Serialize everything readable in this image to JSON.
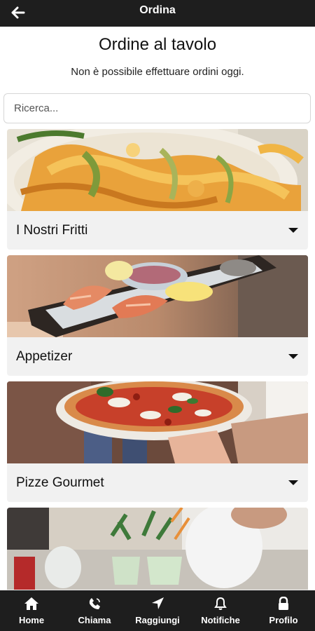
{
  "header": {
    "title": "Ordina",
    "back_icon": "arrow-left-icon"
  },
  "intro": {
    "title": "Ordine al tavolo",
    "subtitle": "Non è possibile effettuare ordini oggi."
  },
  "search": {
    "placeholder": "Ricerca...",
    "value": ""
  },
  "categories": [
    {
      "label": "I Nostri Fritti",
      "image": "fried-food-photo"
    },
    {
      "label": "Appetizer",
      "image": "seafood-platter-photo"
    },
    {
      "label": "Pizze Gourmet",
      "image": "pizza-photo"
    },
    {
      "label": "",
      "image": "cocktails-photo"
    }
  ],
  "bottom_nav": [
    {
      "label": "Home",
      "icon": "home-icon"
    },
    {
      "label": "Chiama",
      "icon": "phone-icon"
    },
    {
      "label": "Raggiungi",
      "icon": "location-arrow-icon"
    },
    {
      "label": "Notifiche",
      "icon": "bell-icon"
    },
    {
      "label": "Profilo",
      "icon": "lock-icon"
    }
  ],
  "colors": {
    "bar_background": "#1e1e1e",
    "card_footer": "#f1f1f1",
    "text": "#111111"
  }
}
